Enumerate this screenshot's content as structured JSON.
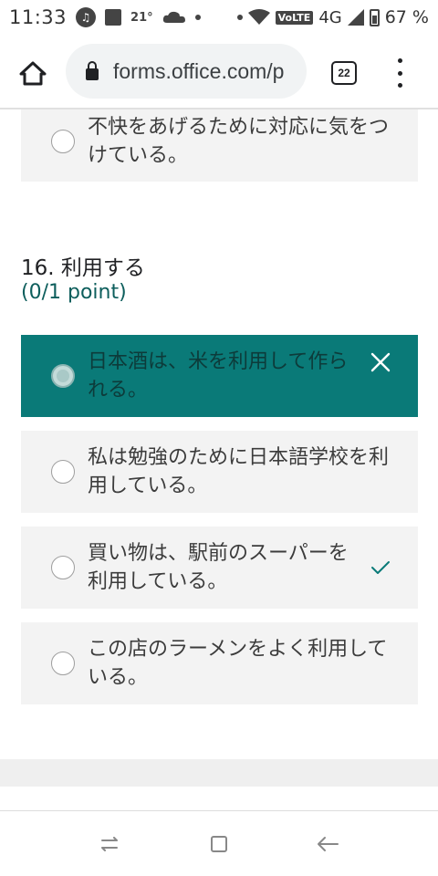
{
  "status_bar": {
    "time": "11:33",
    "temperature": "21°",
    "network": "4G",
    "volte": "VoLTE",
    "battery": "67 %",
    "icons": [
      "music-icon",
      "image-icon",
      "cloud-icon",
      "wifi-icon",
      "signal-icon",
      "battery-icon"
    ]
  },
  "browser": {
    "url": "forms.office.com/p",
    "tab_count": "22"
  },
  "question": {
    "title": "16. 利用する",
    "points": "(0/1 point)"
  },
  "options": {
    "previous": "不快をあげるために対応に気をつけている。",
    "opt1": "日本酒は、米を利用して作られる。",
    "opt2": "私は勉強のために日本語学校を利用している。",
    "opt3": "買い物は、駅前のスーパーを利用している。",
    "opt4": "この店のラーメンをよく利用している。"
  },
  "colors": {
    "selected_bg": "#0a7a78",
    "option_bg": "#f3f3f3",
    "accent": "#0d5e5c",
    "correct_check": "#0a7a78"
  }
}
